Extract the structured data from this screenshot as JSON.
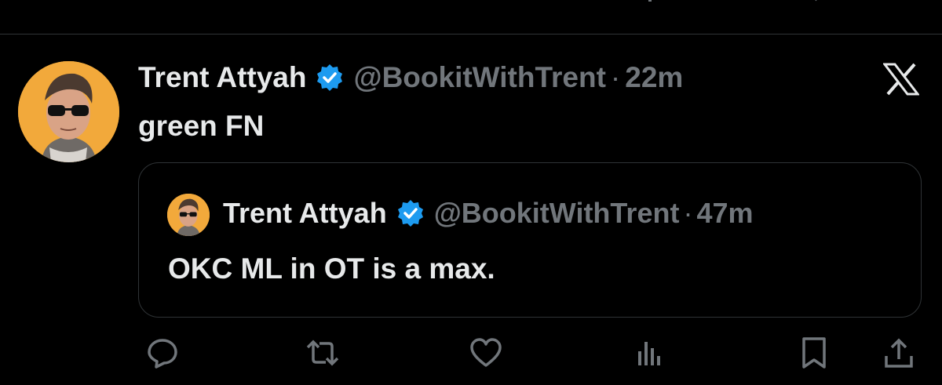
{
  "post": {
    "author_name": "Trent Attyah",
    "handle": "@BookitWithTrent",
    "separator": "·",
    "time": "22m",
    "text": "green FN"
  },
  "quoted_post": {
    "author_name": "Trent Attyah",
    "handle": "@BookitWithTrent",
    "separator": "·",
    "time": "47m",
    "text": "OKC ML in OT is a max."
  },
  "icons": {
    "verified": "verified-badge-icon",
    "platform": "x-logo-icon",
    "actions": [
      "reply-icon",
      "repost-icon",
      "like-icon",
      "views-icon",
      "bookmark-icon",
      "share-icon"
    ]
  },
  "colors": {
    "background": "#000000",
    "text": "#e7e9ea",
    "secondary": "#71767b",
    "border": "#2f3336",
    "verified": "#1d9bf0",
    "avatar_bg": "#f2a93b"
  }
}
